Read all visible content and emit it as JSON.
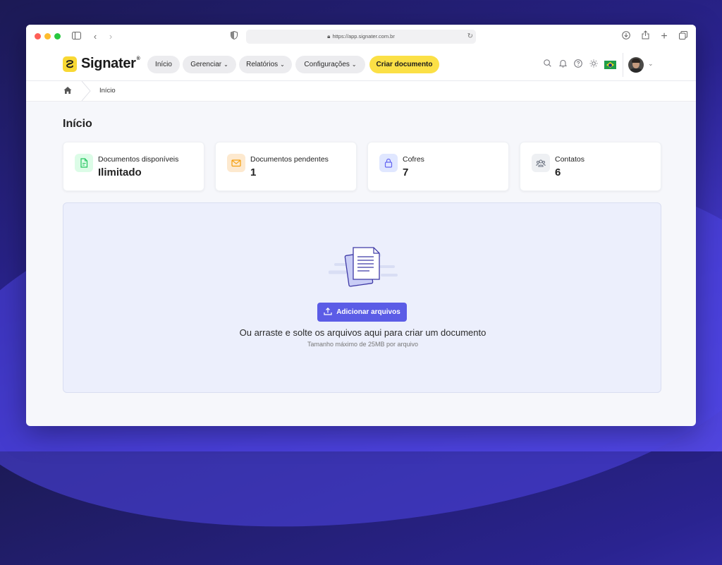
{
  "browser": {
    "url": "https://app.signater.com.br",
    "traffic_colors": [
      "#ff5f57",
      "#febc2e",
      "#28c840"
    ]
  },
  "header": {
    "brand": "Signater",
    "brand_mark": "®",
    "nav": [
      {
        "label": "Início",
        "dropdown": false
      },
      {
        "label": "Gerenciar",
        "dropdown": true
      },
      {
        "label": "Relatórios",
        "dropdown": true
      },
      {
        "label": "Configurações",
        "dropdown": true
      }
    ],
    "cta_label": "Criar documento",
    "icons": [
      "search-icon",
      "bell-icon",
      "help-icon",
      "sun-icon"
    ],
    "colors": {
      "cta": "#fbe046",
      "logo": "#f8d834"
    }
  },
  "breadcrumb": {
    "current": "Início"
  },
  "page": {
    "title": "Início"
  },
  "stats": [
    {
      "label": "Documentos disponíveis",
      "value": "Ilimitado",
      "icon": "document-icon",
      "color": "#22c55e"
    },
    {
      "label": "Documentos pendentes",
      "value": "1",
      "icon": "mail-icon",
      "color": "#f59e0b"
    },
    {
      "label": "Cofres",
      "value": "7",
      "icon": "lock-icon",
      "color": "#6366f1"
    },
    {
      "label": "Contatos",
      "value": "6",
      "icon": "users-icon",
      "color": "#6b7280"
    }
  ],
  "upload": {
    "button_label": "Adicionar arquivos",
    "hint": "Ou arraste e solte os arquivos aqui para criar um documento",
    "limit": "Tamanho máximo de 25MB por arquivo",
    "accent": "#5b5ce6"
  }
}
